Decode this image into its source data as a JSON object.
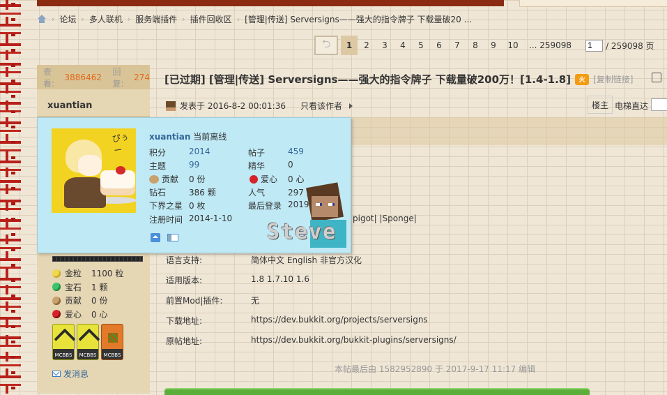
{
  "breadcrumb": {
    "items": [
      "论坛",
      "多人联机",
      "服务端插件",
      "插件回收区",
      "[管理|传送] Serversigns——强大的指令牌子 下载量破20 ..."
    ]
  },
  "pager": {
    "pages": [
      "1",
      "2",
      "3",
      "4",
      "5",
      "6",
      "7",
      "8",
      "9",
      "10"
    ],
    "current": "1",
    "last": "... 259098",
    "input_value": "1",
    "total": "/ 259098 页"
  },
  "stats": {
    "views_label": "查看:",
    "views": "3886462",
    "replies_label": "回复:",
    "replies": "274"
  },
  "author": {
    "name": "xuantian"
  },
  "thread": {
    "title": "[已过期] [管理|传送] Serversigns——强大的指令牌子 下载量破200万！[1.4-1.8]",
    "title_icon": "火",
    "copy_link": "[复制链接]"
  },
  "post_meta": {
    "posted": "发表于 2016-8-2 00:01:36",
    "only_author": "只看该作者",
    "floor": "楼主",
    "jump_label": "电梯直达"
  },
  "card": {
    "name": "xuantian",
    "status": "当前离线",
    "avatar_text": "ぴぅー",
    "fields": [
      {
        "label": "积分",
        "value": "2014",
        "blue": true
      },
      {
        "label": "帖子",
        "value": "459",
        "blue": true
      },
      {
        "label": "主题",
        "value": "99",
        "blue": true
      },
      {
        "label": "精华",
        "value": "0",
        "blue": false
      },
      {
        "label": "贡献",
        "value": "0 份",
        "icon": "cookie-icon"
      },
      {
        "label": "爱心",
        "value": "0 心",
        "icon": "heart-icon"
      },
      {
        "label": "钻石",
        "value": "386 颗"
      },
      {
        "label": "人气",
        "value": "297 点"
      },
      {
        "label": "下界之星",
        "value": "0 枚"
      },
      {
        "label": "最后登录",
        "value": "2019-3-31"
      },
      {
        "label": "注册时间",
        "value": "2014-1-10"
      }
    ]
  },
  "steve_label": "Steve",
  "left_stats": [
    {
      "label": "金粒",
      "value": "1100 粒",
      "icon": "gold-nugget-icon"
    },
    {
      "label": "宝石",
      "value": "1 颗",
      "icon": "emerald-icon"
    },
    {
      "label": "贡献",
      "value": "0 份",
      "icon": "cookie-icon"
    },
    {
      "label": "爱心",
      "value": "0 心",
      "icon": "heart-icon"
    }
  ],
  "medals": [
    "MCBBS",
    "MCBBS",
    "MCBBS"
  ],
  "send_message": "发消息",
  "info": [
    {
      "label": "语言支持:",
      "value": "简体中文 English 非官方汉化"
    },
    {
      "label": "适用版本:",
      "value": "1.8 1.7.10 1.6"
    },
    {
      "label": "前置Mod|插件:",
      "value": "无"
    },
    {
      "label": "下载地址:",
      "value": "https://dev.bukkit.org/projects/serversigns"
    },
    {
      "label": "原帖地址:",
      "value": "https://dev.bukkit.org/bukkit-plugins/serversigns/"
    }
  ],
  "platform_tail": "pigot|  |Sponge|",
  "edited": "本帖最后由 1582952890 于 2017-9-17 11:17 编辑",
  "colors": {
    "accent_orange": "#e06a1a",
    "link_blue": "#336699",
    "card_bg": "#bfe9f5",
    "sidebar_bg": "#e5d6b4"
  }
}
